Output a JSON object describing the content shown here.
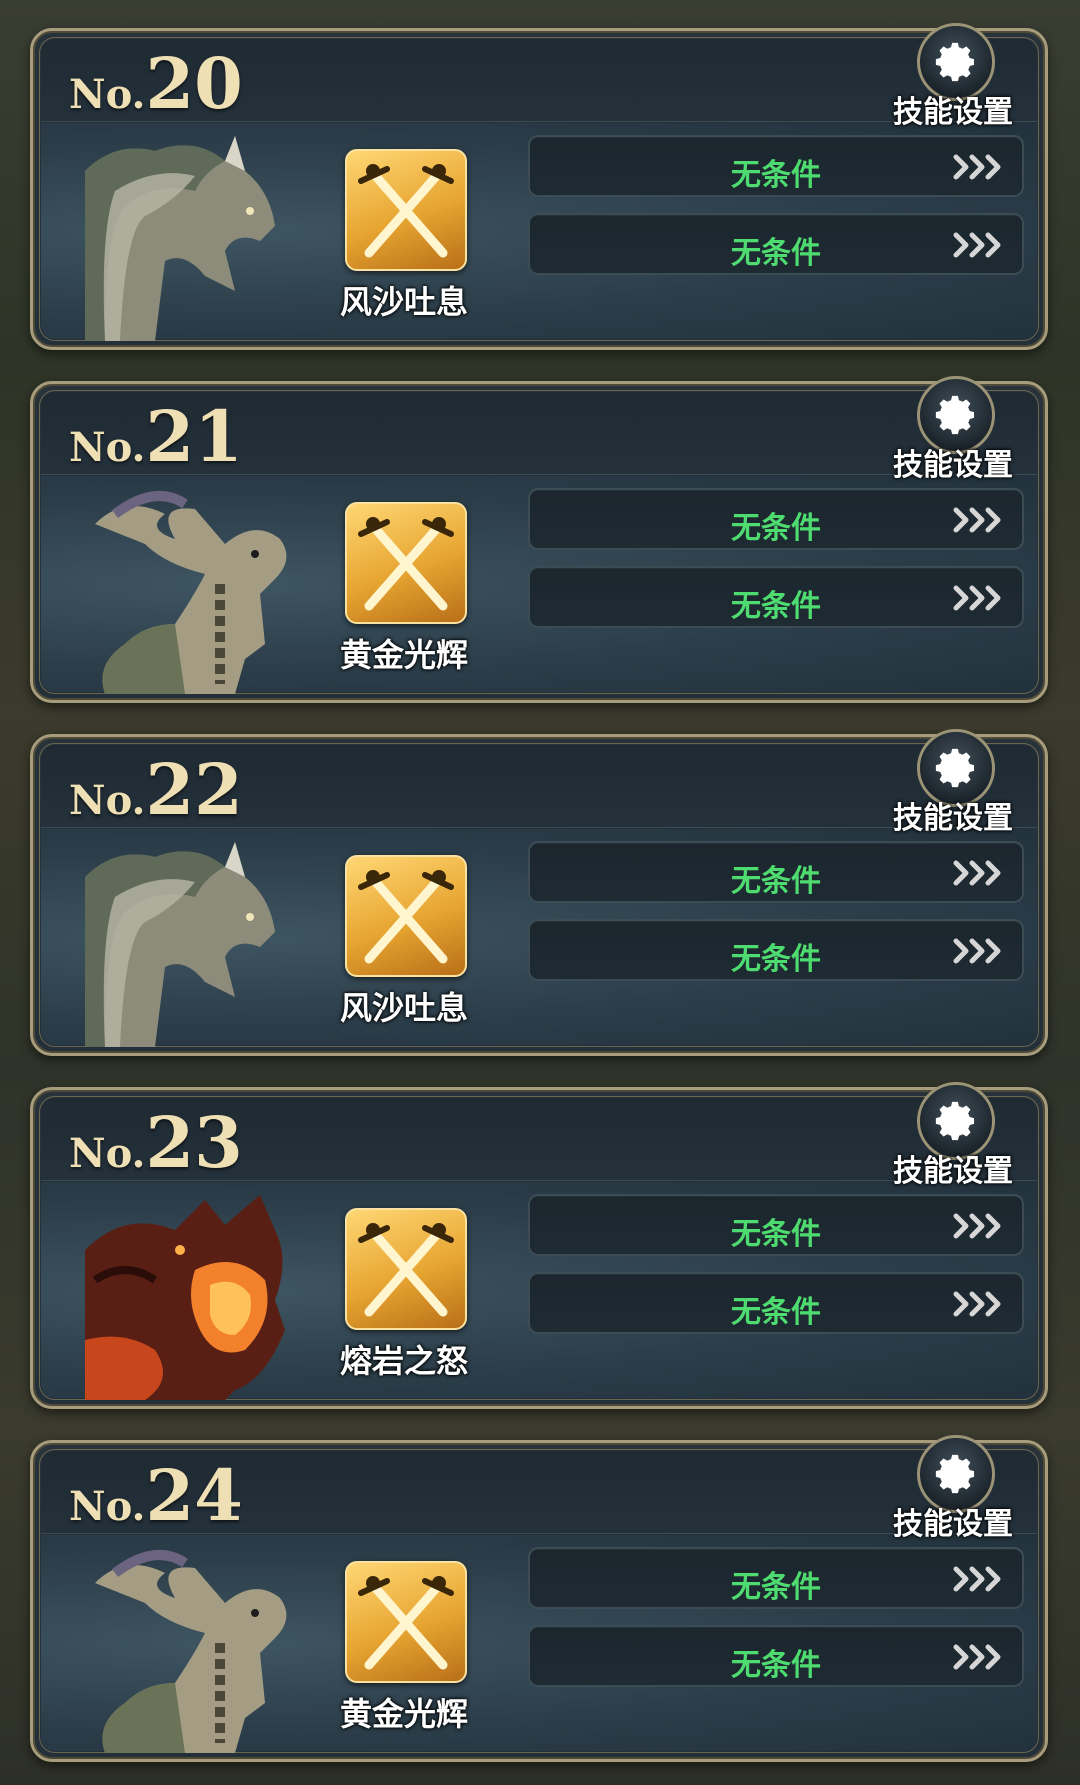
{
  "theme": {
    "frame_color": "#a79d7c",
    "condition_text_color": "#4edb6f",
    "number_color": "#efdfb4",
    "skill_icon_color": "#e7a531"
  },
  "slots": [
    {
      "number_prefix": "No.",
      "number": "20",
      "settings_label": "技能设置",
      "settings_icon": "gear-icon",
      "dragon": "grey-horned-dragon",
      "skill_name": "风沙吐息",
      "skill_icon": "crossed-swords-icon",
      "conditions": [
        {
          "label": "无条件",
          "icon": "triple-chevron-right-icon"
        },
        {
          "label": "无条件",
          "icon": "triple-chevron-right-icon"
        }
      ]
    },
    {
      "number_prefix": "No.",
      "number": "21",
      "settings_label": "技能设置",
      "settings_icon": "gear-icon",
      "dragon": "chained-stone-dragon",
      "skill_name": "黄金光辉",
      "skill_icon": "crossed-swords-icon",
      "conditions": [
        {
          "label": "无条件",
          "icon": "triple-chevron-right-icon"
        },
        {
          "label": "无条件",
          "icon": "triple-chevron-right-icon"
        }
      ]
    },
    {
      "number_prefix": "No.",
      "number": "22",
      "settings_label": "技能设置",
      "settings_icon": "gear-icon",
      "dragon": "grey-horned-dragon",
      "skill_name": "风沙吐息",
      "skill_icon": "crossed-swords-icon",
      "conditions": [
        {
          "label": "无条件",
          "icon": "triple-chevron-right-icon"
        },
        {
          "label": "无条件",
          "icon": "triple-chevron-right-icon"
        }
      ]
    },
    {
      "number_prefix": "No.",
      "number": "23",
      "settings_label": "技能设置",
      "settings_icon": "gear-icon",
      "dragon": "lava-dragon",
      "skill_name": "熔岩之怒",
      "skill_icon": "crossed-swords-icon",
      "conditions": [
        {
          "label": "无条件",
          "icon": "triple-chevron-right-icon"
        },
        {
          "label": "无条件",
          "icon": "triple-chevron-right-icon"
        }
      ]
    },
    {
      "number_prefix": "No.",
      "number": "24",
      "settings_label": "技能设置",
      "settings_icon": "gear-icon",
      "dragon": "chained-stone-dragon",
      "skill_name": "黄金光辉",
      "skill_icon": "crossed-swords-icon",
      "conditions": [
        {
          "label": "无条件",
          "icon": "triple-chevron-right-icon"
        },
        {
          "label": "无条件",
          "icon": "triple-chevron-right-icon"
        }
      ]
    }
  ]
}
